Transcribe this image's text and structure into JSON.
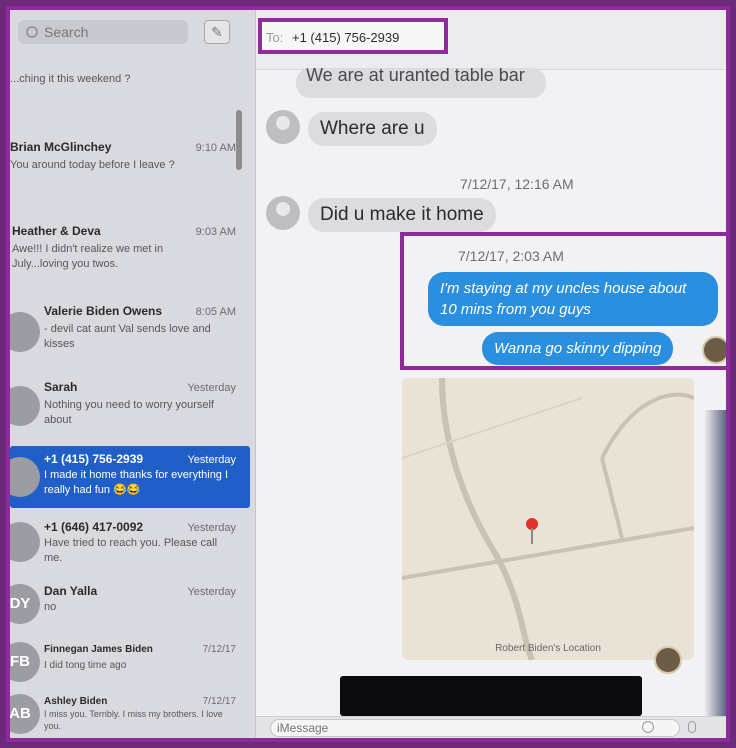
{
  "search": {
    "placeholder": "Search"
  },
  "compose_glyph": "✎",
  "conversations": [
    {
      "name": "",
      "time": "",
      "snippet": "...ching it this weekend ?",
      "initials": ""
    },
    {
      "name": "Brian McGlinchey",
      "time": "9:10 AM",
      "snippet": "You around today before I leave ?",
      "initials": ""
    },
    {
      "name": "Heather & Deva",
      "time": "9:03 AM",
      "snippet": "Awe!!! I didn't realize we met in July...loving you twos.",
      "initials": ""
    },
    {
      "name": "Valerie Biden Owens",
      "time": "8:05 AM",
      "snippet": "- devil cat aunt Val sends love and kisses",
      "initials": ""
    },
    {
      "name": "Sarah",
      "time": "Yesterday",
      "snippet": "Nothing you need to worry yourself about",
      "initials": ""
    },
    {
      "name": "+1 (415) 756-2939",
      "time": "Yesterday",
      "snippet": "I made it home thanks for everything I really had fun 😂😂",
      "initials": "",
      "selected": true
    },
    {
      "name": "+1 (646) 417-0092",
      "time": "Yesterday",
      "snippet": "Have tried to reach you. Please call me.",
      "initials": ""
    },
    {
      "name": "Dan Yalla",
      "time": "Yesterday",
      "snippet": "no",
      "initials": "DY"
    },
    {
      "name": "Finnegan James Biden",
      "time": "7/12/17",
      "snippet": "I did tong time ago",
      "initials": "FB"
    },
    {
      "name": "Ashley Biden",
      "time": "7/12/17",
      "snippet": "I miss you. Terribly. I miss my brothers. I love you.",
      "initials": "AB"
    }
  ],
  "chat": {
    "to_label": "To:",
    "to_value": "+1 (415) 756-2939",
    "cut_off_message": "We are at uranted table bar",
    "messages_in": [
      "Where are u",
      "Did u make it home"
    ],
    "timestamps": [
      "7/12/17, 12:16 AM",
      "7/12/17, 2:03 AM"
    ],
    "messages_out": [
      "I'm staying at my uncles house about 10 mins from you guys",
      "Wanna go skinny dipping"
    ],
    "map_caption": "Robert Biden's Location",
    "input_placeholder": "iMessage"
  },
  "colors": {
    "highlight": "#8e2a9c",
    "selected": "#1f5fc7",
    "outgoing": "#2b8fe0"
  }
}
